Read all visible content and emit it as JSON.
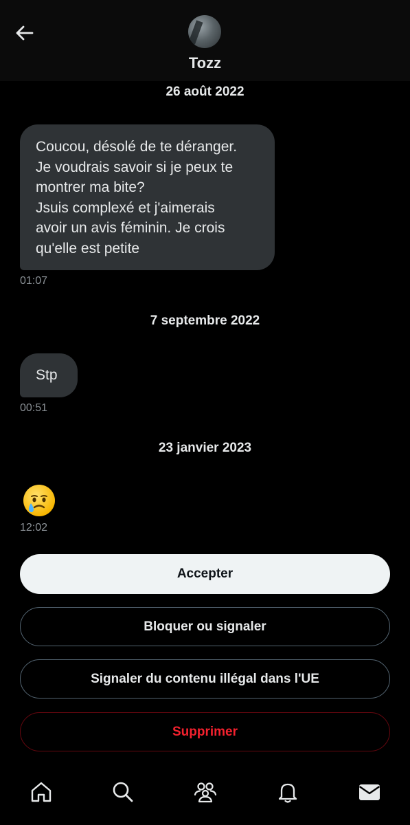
{
  "header": {
    "name": "Tozz"
  },
  "conversation": {
    "groups": [
      {
        "date": "26 août 2022",
        "message_lines": [
          "Coucou, désolé de te déranger.",
          "Je voudrais savoir si je peux te",
          "montrer ma bite?",
          "Jsuis complexé et j'aimerais",
          "avoir un avis féminin. Je crois",
          "qu'elle est petite"
        ],
        "time": "01:07"
      },
      {
        "date": "7 septembre 2022",
        "message_lines": [
          "Stp"
        ],
        "time": "00:51"
      },
      {
        "date": "23 janvier 2023",
        "emoji": "face-holding-back-tears",
        "time": "12:02"
      }
    ]
  },
  "actions": {
    "accept": "Accepter",
    "block_report": "Bloquer ou signaler",
    "report_illegal": "Signaler du contenu illégal dans l'UE",
    "delete": "Supprimer"
  },
  "nav": {
    "icons": [
      "home-icon",
      "search-icon",
      "communities-icon",
      "notifications-icon",
      "messages-icon"
    ],
    "active": "messages-icon"
  },
  "colors": {
    "background": "#000000",
    "bubble": "#2f3336",
    "danger": "#f4212e",
    "primary_button": "#eff3f4"
  }
}
